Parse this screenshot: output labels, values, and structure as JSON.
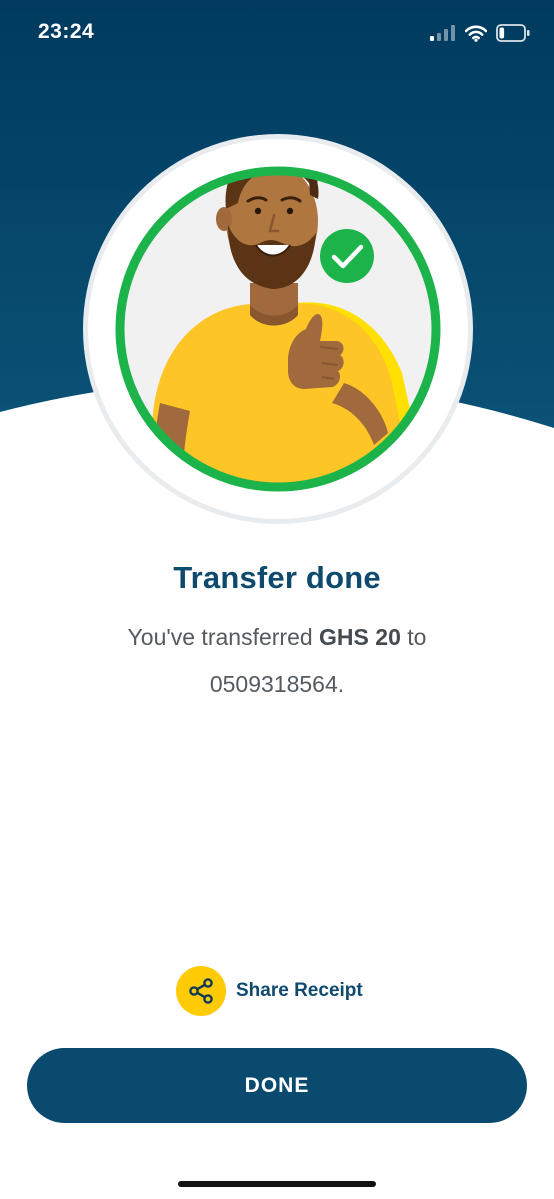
{
  "status_bar": {
    "time": "23:24",
    "signal_icon": "cellular-signal-icon",
    "wifi_icon": "wifi-icon",
    "battery_icon": "battery-icon",
    "battery_level": 0.2
  },
  "hero": {
    "illustration": "smiling-man-thumbs-up-illustration",
    "badge_icon": "checkmark-icon"
  },
  "result": {
    "title": "Transfer done",
    "message_prefix": "You've transferred ",
    "amount": "GHS 20",
    "message_middle": " to ",
    "recipient": "0509318564",
    "message_suffix": "."
  },
  "share": {
    "icon": "share-icon",
    "label": "Share Receipt"
  },
  "actions": {
    "done_label": "DONE"
  },
  "colors": {
    "header_top": "#003a60",
    "header_bottom": "#0b5276",
    "brand_blue": "#0e4a6e",
    "success_green": "#1db34b",
    "accent_yellow": "#ffcb05",
    "body_text": "#555a5e"
  }
}
